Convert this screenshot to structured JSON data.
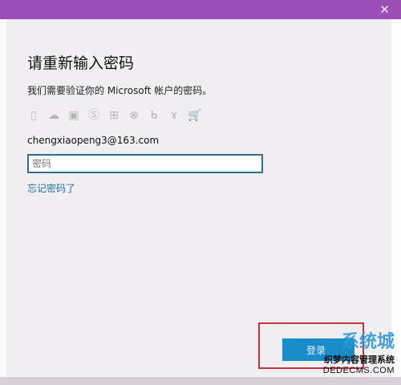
{
  "window": {
    "close_glyph": "✕"
  },
  "dialog": {
    "title": "请重新输入密码",
    "subtitle": "我们需要验证你的 Microsoft 帐户的密码。",
    "email": "chengxiaopeng3@163.com",
    "password": {
      "placeholder": "密码",
      "value": ""
    },
    "forgot_label": "忘记密码了",
    "login_label": "登录"
  },
  "icons": [
    "office-icon",
    "onedrive-icon",
    "outlook-icon",
    "skype-icon",
    "windows-icon",
    "xbox-icon",
    "bing-icon",
    "msn-icon",
    "store-icon"
  ],
  "watermark": {
    "site": "系统城",
    "caption": "织梦内容管理系统",
    "url": "DEDECMS.COM"
  },
  "colors": {
    "title_bar": "#9b4fb6",
    "dialog_bg": "#f1eff1",
    "accent": "#1f6fa8",
    "button": "#1a8cc9",
    "highlight": "#c9343c"
  }
}
